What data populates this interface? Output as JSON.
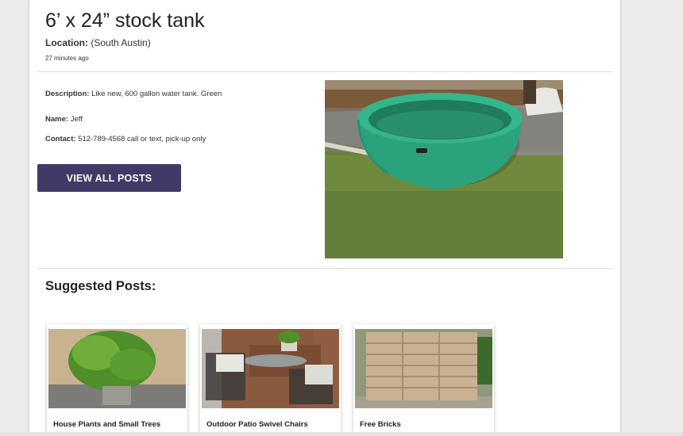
{
  "post": {
    "title": "6’ x 24” stock tank",
    "location_label": "Location:",
    "location_value": "(South Austin)",
    "time_ago": "27 minutes ago",
    "description_label": "Description:",
    "description_value": "Like new, 600 gallon water tank. Green",
    "name_label": "Name:",
    "name_value": "Jeff",
    "contact_label": "Contact:",
    "contact_value": "512-789-4568 call or text, pick-up only"
  },
  "actions": {
    "view_all_label": "VIEW ALL POSTS"
  },
  "suggested": {
    "heading": "Suggested Posts:",
    "items": [
      {
        "title": "House Plants and Small Trees"
      },
      {
        "title": "Outdoor Patio Swivel Chairs"
      },
      {
        "title": "Free Bricks"
      }
    ]
  },
  "colors": {
    "button_bg": "#3f3a66",
    "page_bg": "#ececec",
    "tank_green": "#2aa37c"
  }
}
